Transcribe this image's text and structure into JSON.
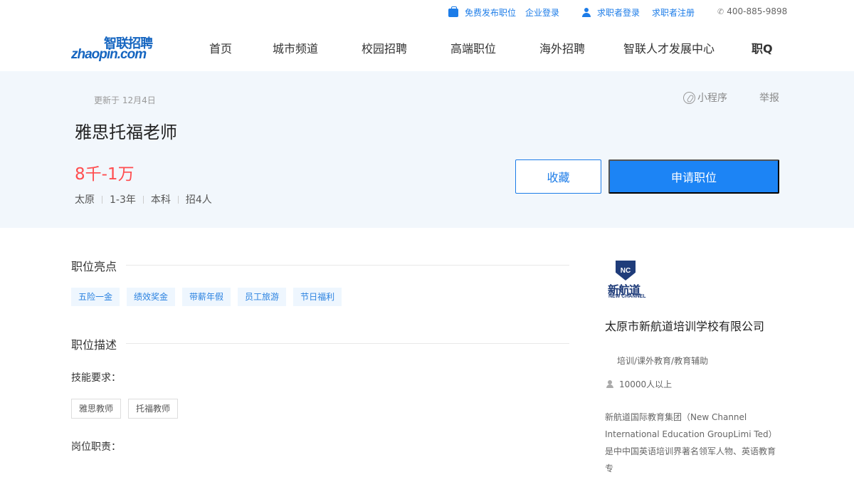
{
  "topbar": {
    "post_job": "免费发布职位",
    "company_login": "企业登录",
    "seeker_login": "求职者登录",
    "seeker_register": "求职者注册",
    "phone": "400-885-9898"
  },
  "logo": {
    "cn": "智联招聘",
    "en": "zhaopin.com"
  },
  "nav": {
    "items": [
      "首页",
      "城市频道",
      "校园招聘",
      "高端职位",
      "海外招聘",
      "智联人才发展中心",
      "职Q"
    ]
  },
  "job": {
    "updated": "更新于 12月4日",
    "mini_program": "小程序",
    "report": "举报",
    "title": "雅思托福老师",
    "salary": "8千-1万",
    "meta": [
      "太原",
      "1-3年",
      "本科",
      "招4人"
    ],
    "fav_label": "收藏",
    "apply_label": "申请职位"
  },
  "highlights": {
    "title": "职位亮点",
    "tags": [
      "五险一金",
      "绩效奖金",
      "带薪年假",
      "员工旅游",
      "节日福利"
    ]
  },
  "description": {
    "title": "职位描述",
    "skills_label": "技能要求：",
    "skills": [
      "雅思教师",
      "托福教师"
    ],
    "duties_label": "岗位职责："
  },
  "company": {
    "logo_cn": "新航道",
    "logo_en": "NEW CHANNEL",
    "logo_badge": "NC",
    "name": "太原市新航道培训学校有限公司",
    "industry": "培训/课外教育/教育辅助",
    "size": "10000人以上",
    "desc": "新航道国际教育集团（New Channel International Education GroupLimi Ted）是中中国英语培训界著名领军人物、英语教育专"
  },
  "colors": {
    "accent": "#1c84f5",
    "salary": "#ff4d4f",
    "hero_bg": "#f2f7fc"
  }
}
